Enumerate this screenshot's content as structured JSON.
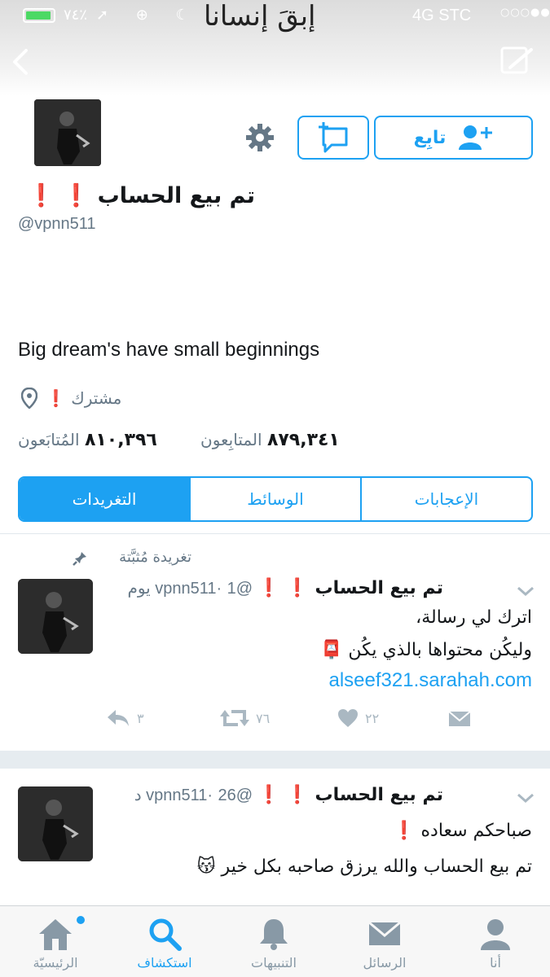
{
  "status_bar": {
    "battery_percent": "٧٤٪",
    "battery_level": 0.74,
    "carrier": "4G  STC",
    "signal": "○○○●●"
  },
  "banner": {
    "text": "إبقَ إنسانا"
  },
  "icons": {
    "back": "back-chevron-icon",
    "compose": "compose-icon",
    "settings": "gear-icon",
    "dm": "direct-message-icon",
    "follow": "add-user-icon",
    "location": "location-pin-icon",
    "pin": "pin-icon"
  },
  "profile": {
    "display_name": "تم بيع الحساب ❗ ❗",
    "handle": "@vpnn511",
    "bio": "Big dream's have small beginnings",
    "location": "مشترك ❗",
    "follow_label": "تابِع",
    "followers": {
      "count": "٨٧٩,٣٤١",
      "label": "المتابِعون"
    },
    "following": {
      "count": "٨١٠,٣٩٦",
      "label": "المُتابَعون"
    }
  },
  "tabs": [
    {
      "label": "التغريدات",
      "active": true
    },
    {
      "label": "الوسائط",
      "active": false
    },
    {
      "label": "الإعجابات",
      "active": false
    }
  ],
  "pinned_label": "تغريدة مُثبَّتة",
  "tweets": [
    {
      "name": "تم بيع الحساب ❗ ❗",
      "handle": "@vpnn511",
      "time": "1 يوم",
      "lines": [
        "اترك لي رسالة،",
        "وليكُن محتواها بالذي يكُن 📮"
      ],
      "link": "alseef321.sarahah.com",
      "replies": "٣",
      "retweets": "٧٦",
      "likes": "٢٢"
    },
    {
      "name": "تم بيع الحساب ❗ ❗",
      "handle": "@vpnn511",
      "time": "26 د",
      "lines": [
        "صباحكم سعاده ❗",
        "تم بيع الحساب والله يرزق صاحبه بكل خير 😽"
      ]
    }
  ],
  "tabbar": [
    {
      "label": "أنا",
      "icon": "person-icon"
    },
    {
      "label": "الرسائل",
      "icon": "envelope-icon"
    },
    {
      "label": "التنبيهات",
      "icon": "bell-icon"
    },
    {
      "label": "استكشاف",
      "icon": "search-icon",
      "active": true
    },
    {
      "label": "الرئيسيّة",
      "icon": "home-icon"
    }
  ],
  "colors": {
    "accent": "#1da1f2",
    "muted": "#657786",
    "icon_gray": "#aab8c2"
  }
}
